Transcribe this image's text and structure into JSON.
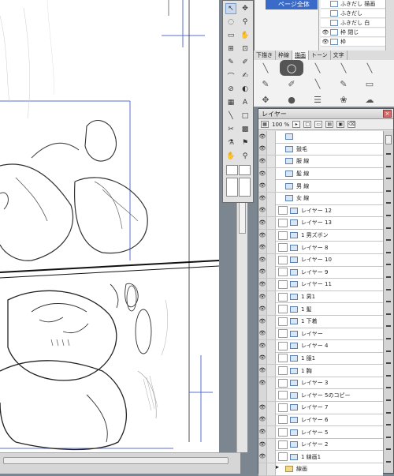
{
  "top_panel": {
    "selected_item": "ページ全体",
    "items": [
      "ふきだし 描画",
      "ふきだし",
      "ふきだし 白",
      "枠 閉じ",
      "枠"
    ]
  },
  "brush_tabs": [
    "下描き",
    "枠線",
    "描画",
    "トーン",
    "文字"
  ],
  "layer_panel": {
    "title": "レイヤー",
    "zoom": "100 %",
    "close_glyph": "×",
    "layers": [
      {
        "name": "",
        "type": "group-child",
        "visible": true
      },
      {
        "name": "鼓毛",
        "type": "group-child",
        "visible": true
      },
      {
        "name": "服 線",
        "type": "group-child",
        "visible": true
      },
      {
        "name": "髪 線",
        "type": "group-child",
        "visible": true
      },
      {
        "name": "男 線",
        "type": "group-child",
        "visible": true
      },
      {
        "name": "女 線",
        "type": "group-child",
        "visible": true
      },
      {
        "name": "レイヤー 12",
        "type": "raster",
        "visible": true
      },
      {
        "name": "レイヤー 13",
        "type": "raster",
        "visible": true
      },
      {
        "name": "1 男ズボン",
        "type": "raster",
        "visible": true
      },
      {
        "name": "レイヤー 8",
        "type": "raster",
        "visible": true
      },
      {
        "name": "レイヤー 10",
        "type": "raster",
        "visible": true
      },
      {
        "name": "レイヤー 9",
        "type": "raster",
        "visible": true
      },
      {
        "name": "レイヤー 11",
        "type": "raster",
        "visible": true
      },
      {
        "name": "1 男1",
        "type": "raster",
        "visible": true
      },
      {
        "name": "1 髪",
        "type": "raster",
        "visible": true
      },
      {
        "name": "1 下着",
        "type": "raster",
        "visible": true
      },
      {
        "name": "レイヤー",
        "type": "raster",
        "visible": true
      },
      {
        "name": "レイヤー 4",
        "type": "raster",
        "visible": true
      },
      {
        "name": "1 服1",
        "type": "raster",
        "visible": true
      },
      {
        "name": "1 胸",
        "type": "raster",
        "visible": true
      },
      {
        "name": "レイヤー 3",
        "type": "raster",
        "visible": true
      },
      {
        "name": "レイヤー 5のコピー",
        "type": "raster",
        "visible": false
      },
      {
        "name": "レイヤー 7",
        "type": "raster",
        "visible": true
      },
      {
        "name": "レイヤー 6",
        "type": "raster",
        "visible": true
      },
      {
        "name": "レイヤー 5",
        "type": "raster",
        "visible": true
      },
      {
        "name": "レイヤー 2",
        "type": "raster",
        "visible": true
      },
      {
        "name": "1 線画1",
        "type": "raster",
        "visible": true
      },
      {
        "name": "線画",
        "type": "folder",
        "visible": false
      }
    ]
  },
  "icons": {
    "eye": "👁",
    "tool_glyphs": [
      "↖",
      "✥",
      "✎",
      "⚲",
      "▭",
      "◌",
      "⌒",
      "✋",
      "⊘",
      "◐",
      "⊞",
      "⊡"
    ]
  },
  "colors": {
    "selection_blue": "#3a6bc8",
    "guide_blue": "#5a6fd0",
    "panel_gray": "#e6e6e6"
  }
}
